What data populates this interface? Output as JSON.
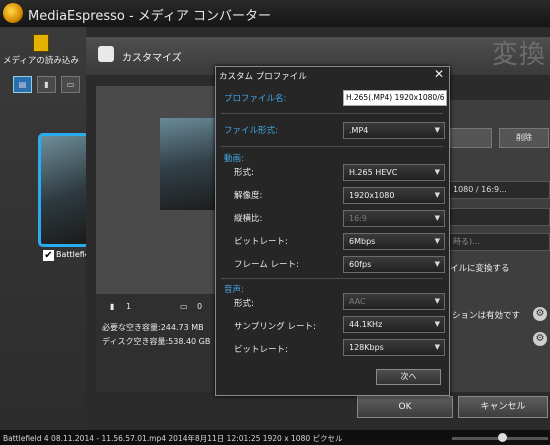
{
  "app": {
    "title": "MediaEspresso - メディア コンバーター"
  },
  "sidebar": {
    "import_label": "メディアの読み込み",
    "view_buttons": [
      "▤",
      "▮",
      "▭"
    ],
    "thumb_label": "Battlefield",
    "thumb_checked": "✔"
  },
  "customize": {
    "title": "カスタマイズ",
    "big_title": "変換"
  },
  "preview": {
    "video_count": "1",
    "image_count": "0",
    "required_space": "必要な空き容量:244.73 MB",
    "free_space": "ディスク空き容量:538.40 GB"
  },
  "right_panel": {
    "delete_label": "削除",
    "resolution_text": "1080 / 16:9...",
    "placeholder_text": "時る)...",
    "convert_text": "イルに変換する",
    "effects_text": "ションは有効です",
    "gear": "⚙"
  },
  "footer": {
    "ok": "OK",
    "cancel": "キャンセル"
  },
  "status": {
    "file_info": "Battlefield 4 08.11.2014 - 11.56.57.01.mp4 2014年8月11日 12:01:25 1920 x 1080 ピクセル"
  },
  "modal": {
    "title": "カスタム プロファイル",
    "close": "✕",
    "profile_name_label": "プロファイル名:",
    "profile_name_value": "H.265(.MP4) 1920x1080/6",
    "file_format_label": "ファイル形式:",
    "file_format_value": ".MP4",
    "video_section": "動画:",
    "video": {
      "format_label": "形式:",
      "format_value": "H.265 HEVC",
      "resolution_label": "解像度:",
      "resolution_value": "1920x1080",
      "aspect_label": "縦横比:",
      "aspect_value": "16:9",
      "bitrate_label": "ビットレート:",
      "bitrate_value": "6Mbps",
      "framerate_label": "フレーム レート:",
      "framerate_value": "60fps"
    },
    "audio_section": "音声:",
    "audio": {
      "format_label": "形式:",
      "format_value": "AAC",
      "samplerate_label": "サンプリング レート:",
      "samplerate_value": "44.1KHz",
      "bitrate_label": "ビットレート:",
      "bitrate_value": "128Kbps"
    },
    "next": "次へ",
    "arrow": "▼"
  }
}
